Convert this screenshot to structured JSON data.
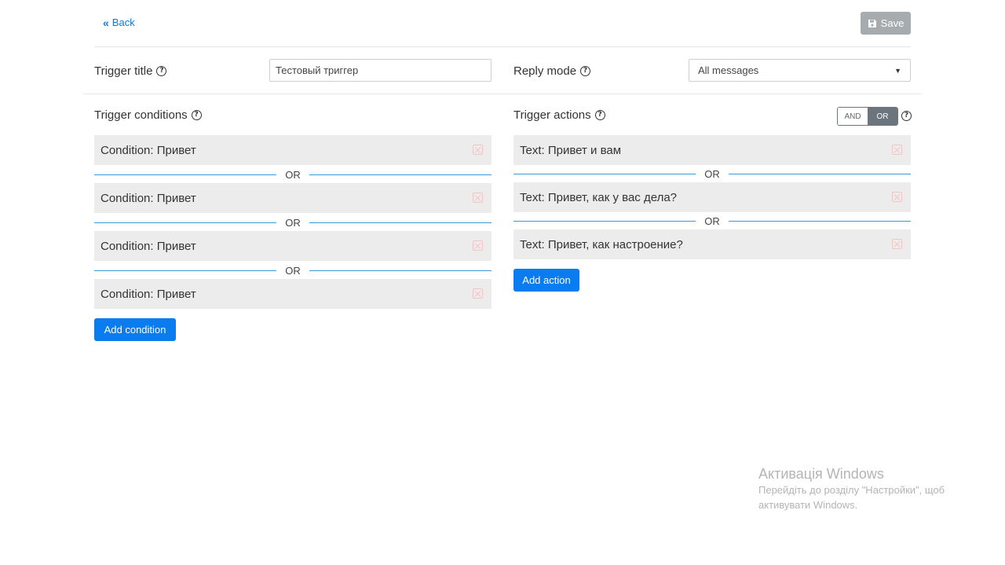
{
  "header": {
    "back_label": "Back",
    "save_label": "Save"
  },
  "settings": {
    "trigger_title_label": "Trigger title",
    "trigger_title_value": "Тестовый триггер",
    "reply_mode_label": "Reply mode",
    "reply_mode_value": "All messages"
  },
  "conditions": {
    "heading": "Trigger conditions",
    "separator": "OR",
    "items": [
      "Condition: Привет",
      "Condition: Привет",
      "Condition: Привет",
      "Condition: Привет"
    ],
    "add_label": "Add condition"
  },
  "actions": {
    "heading": "Trigger actions",
    "separator": "OR",
    "logic_toggle": {
      "options": [
        "AND",
        "OR"
      ],
      "selected": "OR"
    },
    "items": [
      "Text: Привет и вам",
      "Text: Привет, как у вас дела?",
      "Text: Привет, как настроение?"
    ],
    "add_label": "Add action"
  },
  "watermark": {
    "title": "Активація Windows",
    "line1": "Перейдіть до розділу \"Настройки\", щоб",
    "line2": "активувати Windows."
  },
  "icons": {
    "back": "double-chevron-left-icon",
    "save": "floppy-disk-icon",
    "help": "question-circle-icon",
    "remove": "close-x-icon",
    "select_caret": "caret-down-icon"
  },
  "colors": {
    "primary": "#0b7bf0",
    "save_disabled": "#a6abb0",
    "separator_line": "#3a9ad9",
    "item_bg": "#ececec",
    "remove_icon": "#f4c4c4"
  }
}
